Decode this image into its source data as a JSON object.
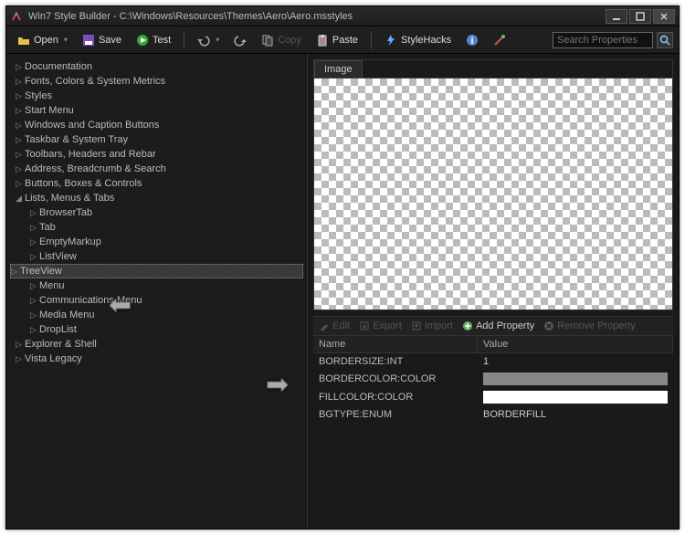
{
  "window": {
    "title": "Win7 Style Builder - C:\\Windows\\Resources\\Themes\\Aero\\Aero.msstyles"
  },
  "toolbar": {
    "open": "Open",
    "save": "Save",
    "test": "Test",
    "copy": "Copy",
    "paste": "Paste",
    "stylehacks": "StyleHacks",
    "search_placeholder": "Search Properties"
  },
  "tree": {
    "items": [
      {
        "label": "Documentation",
        "indent": 0,
        "arrow": "▷"
      },
      {
        "label": "Fonts, Colors & System Metrics",
        "indent": 0,
        "arrow": "▷"
      },
      {
        "label": "Styles",
        "indent": 0,
        "arrow": "▷"
      },
      {
        "label": "Start Menu",
        "indent": 0,
        "arrow": "▷"
      },
      {
        "label": "Windows and Caption Buttons",
        "indent": 0,
        "arrow": "▷"
      },
      {
        "label": "Taskbar & System Tray",
        "indent": 0,
        "arrow": "▷"
      },
      {
        "label": "Toolbars, Headers and Rebar",
        "indent": 0,
        "arrow": "▷"
      },
      {
        "label": "Address, Breadcrumb & Search",
        "indent": 0,
        "arrow": "▷"
      },
      {
        "label": "Buttons, Boxes & Controls",
        "indent": 0,
        "arrow": "▷"
      },
      {
        "label": "Lists, Menus & Tabs",
        "indent": 0,
        "arrow": "◢",
        "expanded": true
      },
      {
        "label": "BrowserTab",
        "indent": 1,
        "arrow": "▷"
      },
      {
        "label": "Tab",
        "indent": 1,
        "arrow": "▷"
      },
      {
        "label": "EmptyMarkup",
        "indent": 1,
        "arrow": "▷"
      },
      {
        "label": "ListView",
        "indent": 1,
        "arrow": "▷"
      },
      {
        "label": "TreeView",
        "indent": 1,
        "arrow": "▷",
        "selected": true
      },
      {
        "label": "Menu",
        "indent": 1,
        "arrow": "▷"
      },
      {
        "label": "Communications Menu",
        "indent": 1,
        "arrow": "▷"
      },
      {
        "label": "Media Menu",
        "indent": 1,
        "arrow": "▷"
      },
      {
        "label": "DropList",
        "indent": 1,
        "arrow": "▷"
      },
      {
        "label": "Explorer & Shell",
        "indent": 0,
        "arrow": "▷"
      },
      {
        "label": "Vista Legacy",
        "indent": 0,
        "arrow": "▷"
      }
    ]
  },
  "image_panel": {
    "tab": "Image"
  },
  "prop_buttons": {
    "edit": "Edit",
    "export": "Export",
    "import": "Import",
    "add": "Add Property",
    "remove": "Remove Property"
  },
  "prop_table": {
    "headers": {
      "name": "Name",
      "value": "Value"
    },
    "rows": [
      {
        "name": "BORDERSIZE:INT",
        "value": "1",
        "type": "text"
      },
      {
        "name": "BORDERCOLOR:COLOR",
        "value": "",
        "type": "swatch-gray"
      },
      {
        "name": "FILLCOLOR:COLOR",
        "value": "",
        "type": "swatch-white"
      },
      {
        "name": "BGTYPE:ENUM",
        "value": "BORDERFILL",
        "type": "text"
      }
    ]
  }
}
